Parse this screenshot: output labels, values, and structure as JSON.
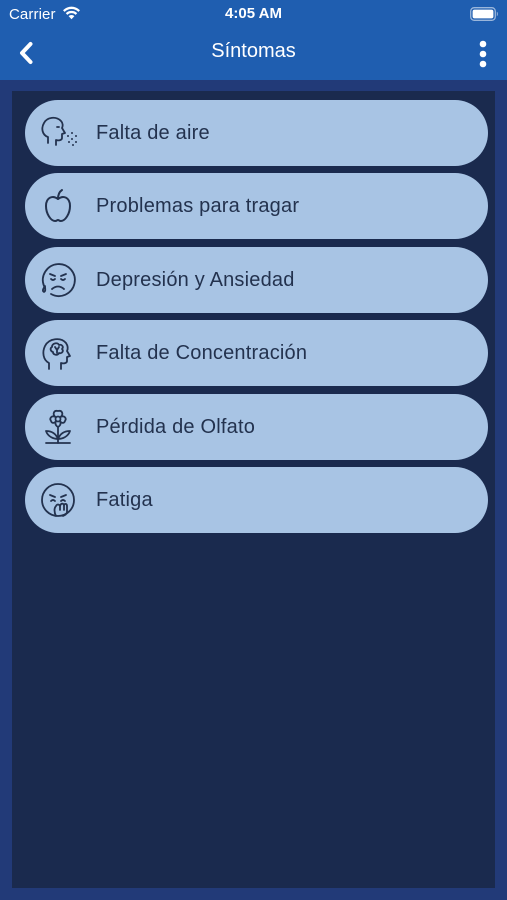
{
  "status_bar": {
    "carrier": "Carrier",
    "time": "4:05 AM"
  },
  "nav": {
    "title": "Síntomas",
    "back_icon": "chevron-left-icon",
    "more_icon": "vertical-ellipsis-icon"
  },
  "colors": {
    "nav_background": "#1f5eb0",
    "panel_background": "#1a2a4e",
    "item_background": "#a8c4e4",
    "item_text": "#23324e"
  },
  "symptoms": [
    {
      "label": "Falta de aire",
      "icon": "breath-face-icon"
    },
    {
      "label": "Problemas para tragar",
      "icon": "apple-icon"
    },
    {
      "label": "Depresión y Ansiedad",
      "icon": "sad-face-icon"
    },
    {
      "label": "Falta de Concentración",
      "icon": "brain-head-icon"
    },
    {
      "label": "Pérdida de Olfato",
      "icon": "flower-icon"
    },
    {
      "label": "Fatiga",
      "icon": "tired-face-icon"
    }
  ]
}
